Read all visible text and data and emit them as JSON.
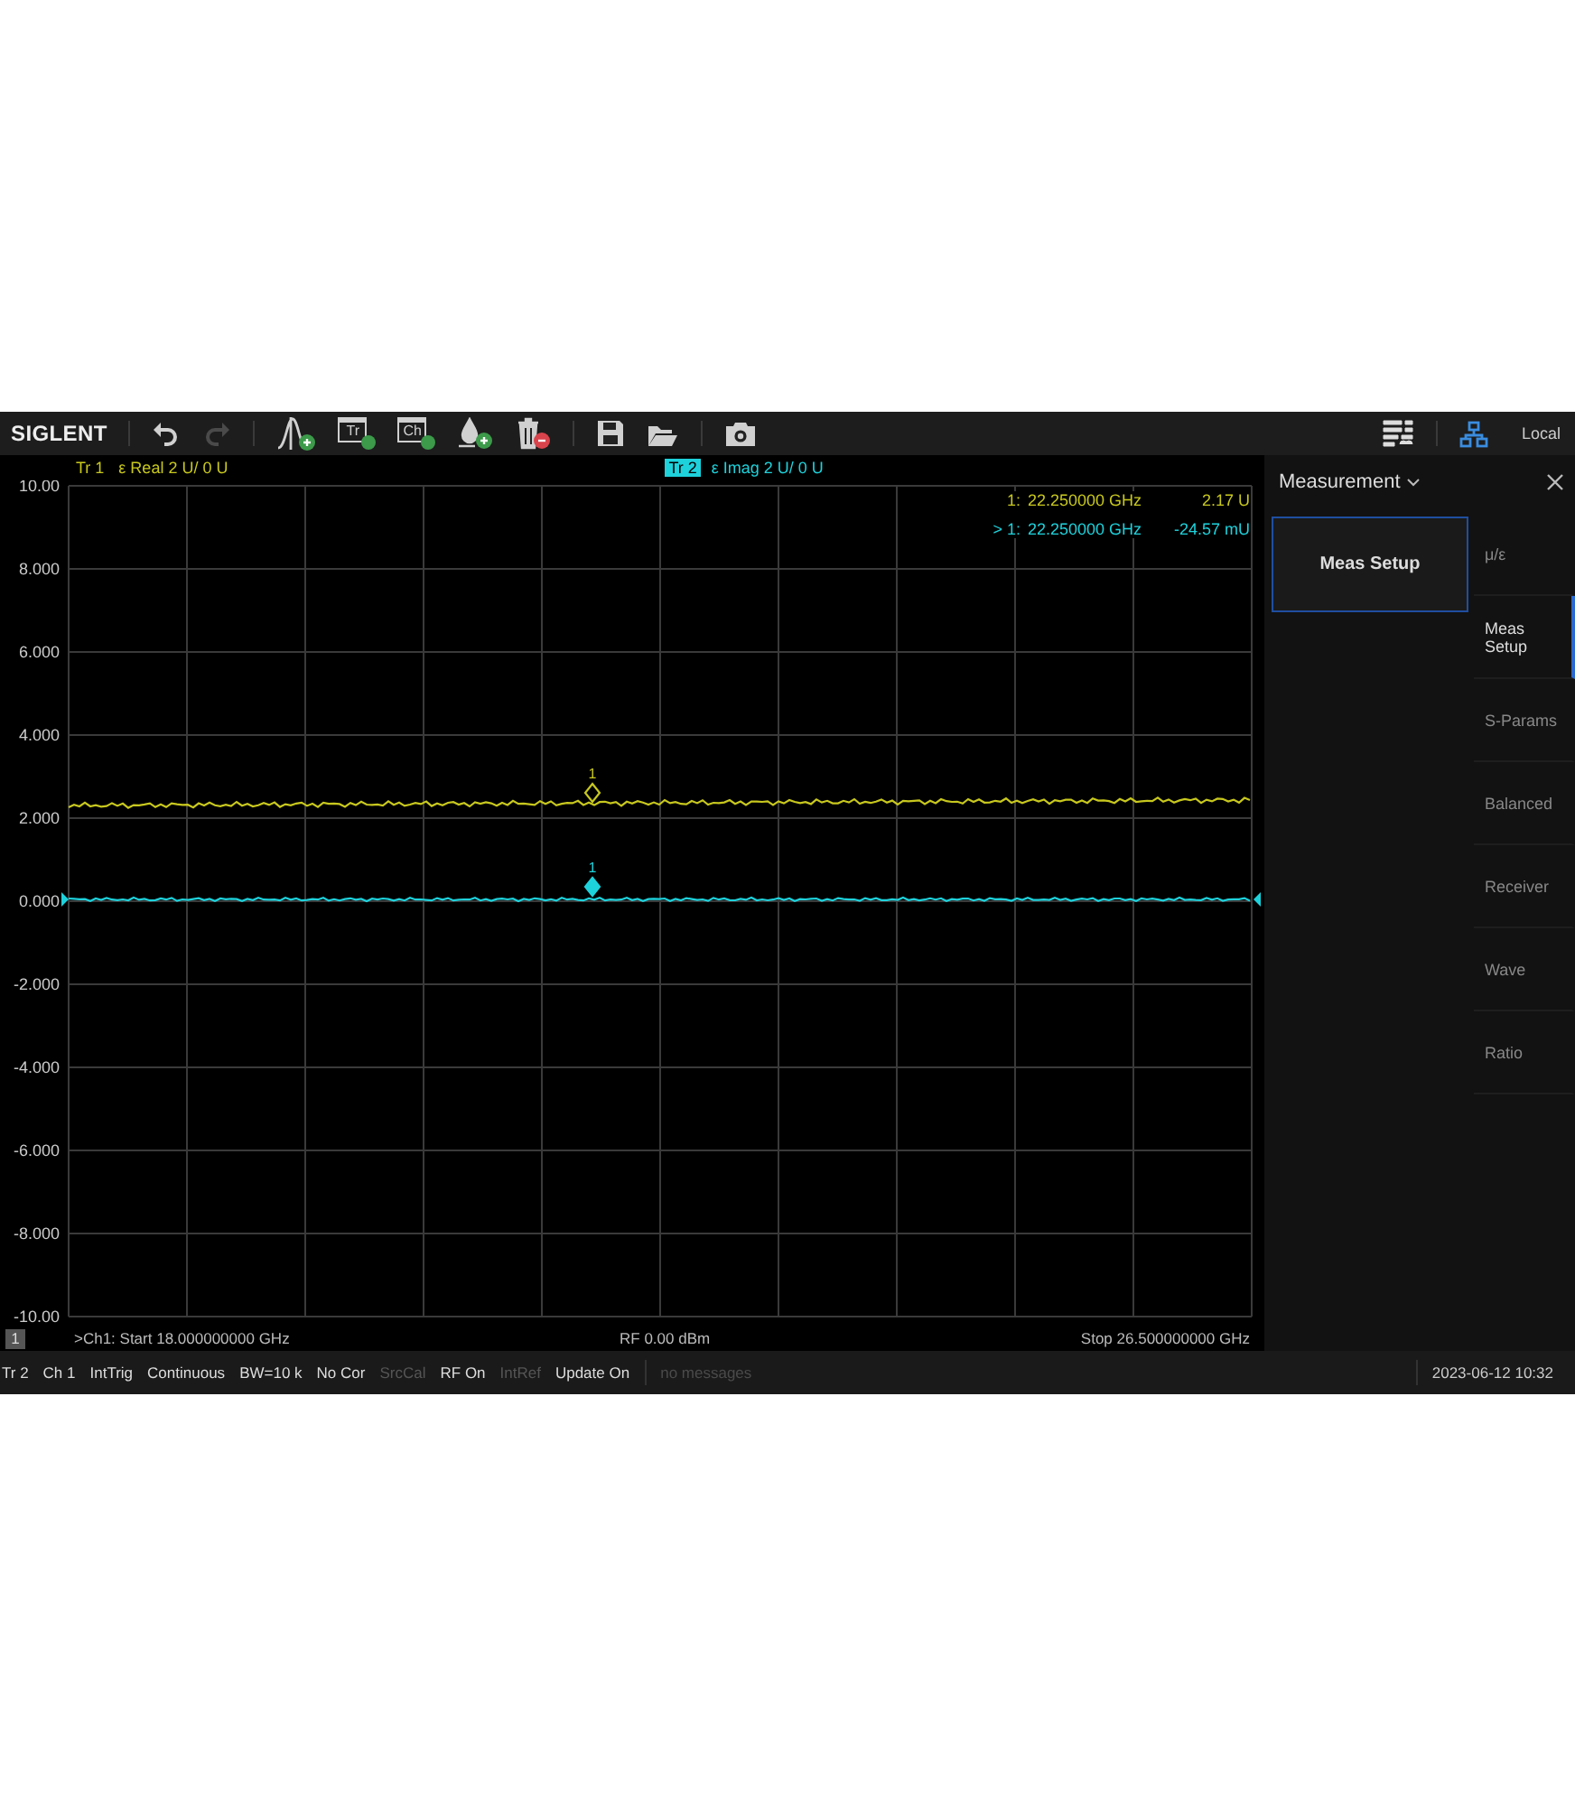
{
  "toolbar": {
    "logo": "SIGLENT",
    "tools": [
      {
        "kind": "undo",
        "disabled": false
      },
      {
        "kind": "redo",
        "disabled": true
      },
      {
        "kind": "add-marker",
        "disabled": false
      },
      {
        "kind": "add-trace",
        "label": "Tr",
        "disabled": false
      },
      {
        "kind": "add-channel",
        "label": "Ch",
        "disabled": false
      },
      {
        "kind": "add-fill",
        "disabled": false
      },
      {
        "kind": "delete",
        "disabled": false
      },
      {
        "kind": "save",
        "disabled": false
      },
      {
        "kind": "open",
        "disabled": false
      },
      {
        "kind": "camera",
        "disabled": false
      }
    ],
    "right_tools": [
      {
        "kind": "layout"
      },
      {
        "kind": "network"
      }
    ],
    "mode": "Local"
  },
  "traces": [
    {
      "name": "Tr 1",
      "format": "ε Real 2 U/ 0 U",
      "color": "#c8c81e",
      "selected": false
    },
    {
      "name": "Tr 2",
      "format": "ε Imag 2 U/ 0 U",
      "color": "#1ed2dc",
      "selected": true
    }
  ],
  "marker_readouts": [
    {
      "prefix": "1:",
      "frequency": "22.250000 GHz",
      "value": "2.17 U",
      "color": "#c8c81e"
    },
    {
      "prefix": "> 1:",
      "frequency": "22.250000 GHz",
      "value": "-24.57 mU",
      "color": "#1ed2dc"
    }
  ],
  "y_axis_labels": [
    "10.00",
    "8.000",
    "6.000",
    "4.000",
    "2.000",
    "0.000",
    "-2.000",
    "-4.000",
    "-6.000",
    "-8.000",
    "-10.00"
  ],
  "markers": [
    {
      "label": "1"
    },
    {
      "label": "1"
    }
  ],
  "channel_info": {
    "channel": "1",
    "start": ">Ch1: Start 18.000000000 GHz",
    "power": "RF 0.00 dBm",
    "stop": "Stop 26.500000000 GHz"
  },
  "panel": {
    "title": "Measurement",
    "softkeys": [
      {
        "label": "Meas Setup",
        "selected": true
      }
    ],
    "tabs": [
      {
        "label": "μ/ε",
        "selected": false
      },
      {
        "label": "Meas Setup",
        "selected": true
      },
      {
        "label": "S-Params",
        "selected": false
      },
      {
        "label": "Balanced",
        "selected": false
      },
      {
        "label": "Receiver",
        "selected": false
      },
      {
        "label": "Wave",
        "selected": false
      },
      {
        "label": "Ratio",
        "selected": false
      }
    ]
  },
  "status_bar": {
    "items": [
      {
        "text": "Tr 2",
        "disabled": false
      },
      {
        "text": "Ch 1",
        "disabled": false
      },
      {
        "text": "IntTrig",
        "disabled": false
      },
      {
        "text": "Continuous",
        "disabled": false
      },
      {
        "text": "BW=10 k",
        "disabled": false
      },
      {
        "text": "No Cor",
        "disabled": false
      },
      {
        "text": "SrcCal",
        "disabled": true
      },
      {
        "text": "RF On",
        "disabled": false
      },
      {
        "text": "IntRef",
        "disabled": true
      },
      {
        "text": "Update On",
        "disabled": false
      }
    ],
    "message": "no messages",
    "datetime": "2023-06-12 10:32"
  }
}
